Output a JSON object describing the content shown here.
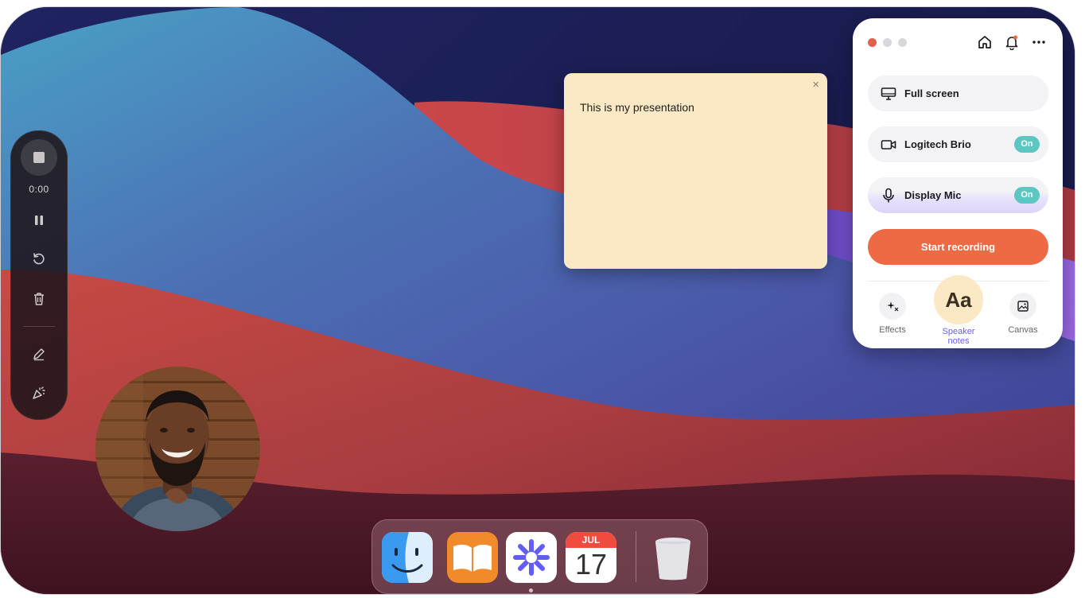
{
  "recorder": {
    "timer": "0:00"
  },
  "note": {
    "text": "This is my presentation",
    "close": "×"
  },
  "panel": {
    "options": {
      "screen": "Full screen",
      "camera": "Logitech Brio",
      "camera_state": "On",
      "mic": "Display Mic",
      "mic_state": "On"
    },
    "start_label": "Start recording",
    "tools": {
      "effects": "Effects",
      "speaker_notes": "Speaker notes",
      "speaker_notes_glyph": "Aa",
      "canvas": "Canvas"
    },
    "colors": {
      "accent": "#ee6a44",
      "toggle": "#5cc6c2",
      "active_tool": "#6a61e0"
    }
  },
  "dock": {
    "calendar_month": "JUL",
    "calendar_day": "17",
    "apps": [
      "finder-icon",
      "books-icon",
      "loom-icon",
      "calendar-icon",
      "trash-icon"
    ]
  }
}
